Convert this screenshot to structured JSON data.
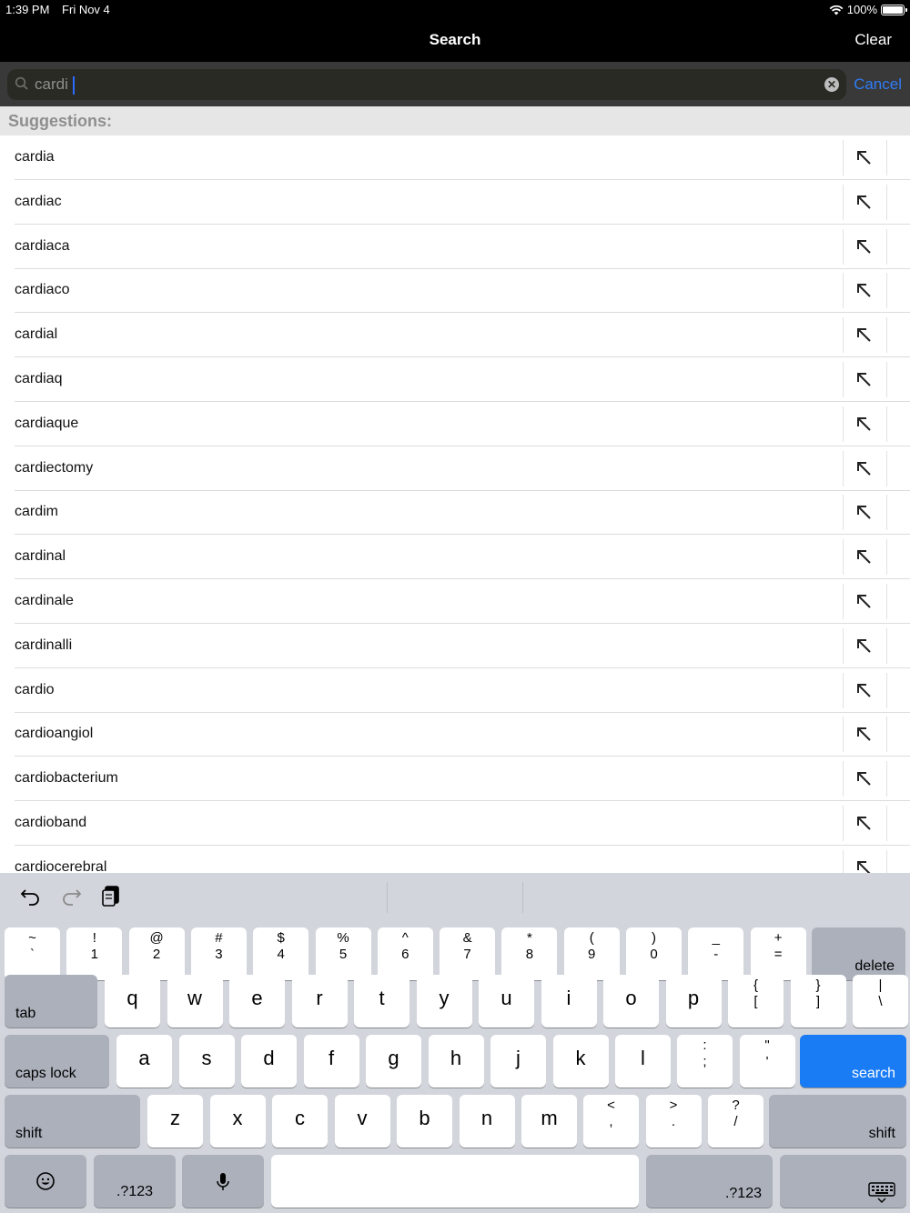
{
  "status": {
    "time": "1:39 PM",
    "date": "Fri Nov 4",
    "battery": "100%",
    "battery_level": 1.0
  },
  "nav": {
    "title": "Search",
    "clear": "Clear"
  },
  "search": {
    "value": "cardi",
    "cancel": "Cancel"
  },
  "suggestions_header": "Suggestions:",
  "suggestions": [
    "cardia",
    "cardiac",
    "cardiaca",
    "cardiaco",
    "cardial",
    "cardiaq",
    "cardiaque",
    "cardiectomy",
    "cardim",
    "cardinal",
    "cardinale",
    "cardinalli",
    "cardio",
    "cardioangiol",
    "cardiobacterium",
    "cardioband",
    "cardiocerebral"
  ],
  "keyboard": {
    "row1": [
      {
        "top": "~",
        "bottom": "`"
      },
      {
        "top": "!",
        "bottom": "1"
      },
      {
        "top": "@",
        "bottom": "2"
      },
      {
        "top": "#",
        "bottom": "3"
      },
      {
        "top": "$",
        "bottom": "4"
      },
      {
        "top": "%",
        "bottom": "5"
      },
      {
        "top": "^",
        "bottom": "6"
      },
      {
        "top": "&",
        "bottom": "7"
      },
      {
        "top": "*",
        "bottom": "8"
      },
      {
        "top": "(",
        "bottom": "9"
      },
      {
        "top": ")",
        "bottom": "0"
      },
      {
        "top": "_",
        "bottom": "-"
      },
      {
        "top": "+",
        "bottom": "="
      }
    ],
    "delete": "delete",
    "tab": "tab",
    "row2": [
      "q",
      "w",
      "e",
      "r",
      "t",
      "y",
      "u",
      "i",
      "o",
      "p"
    ],
    "row2_sym": [
      {
        "top": "{",
        "bottom": "["
      },
      {
        "top": "}",
        "bottom": "]"
      },
      {
        "top": "|",
        "bottom": "\\"
      }
    ],
    "caps_lock": "caps lock",
    "row3": [
      "a",
      "s",
      "d",
      "f",
      "g",
      "h",
      "j",
      "k",
      "l"
    ],
    "row3_sym": [
      {
        "top": ":",
        "bottom": ";"
      },
      {
        "top": "\"",
        "bottom": "'"
      }
    ],
    "search": "search",
    "shift": "shift",
    "row4": [
      "z",
      "x",
      "c",
      "v",
      "b",
      "n",
      "m"
    ],
    "row4_sym": [
      {
        "top": "<",
        "bottom": ","
      },
      {
        "top": ">",
        "bottom": "."
      },
      {
        "top": "?",
        "bottom": "/"
      }
    ],
    "numbers": ".?123"
  }
}
